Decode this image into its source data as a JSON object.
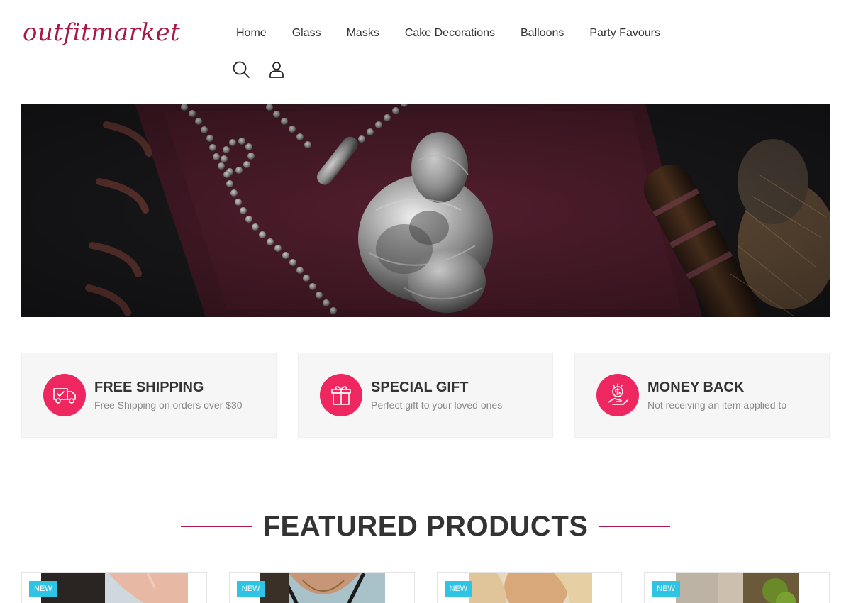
{
  "header": {
    "logo_text": "outfitmarket",
    "logo_color": "#a8184a",
    "nav": [
      {
        "label": "Home"
      },
      {
        "label": "Glass"
      },
      {
        "label": "Masks"
      },
      {
        "label": "Cake Decorations"
      },
      {
        "label": "Balloons"
      },
      {
        "label": "Party Favours"
      }
    ],
    "icons": [
      "search-icon",
      "user-icon"
    ]
  },
  "hero": {
    "image": "dragon-pendant-necklace-banner"
  },
  "features": [
    {
      "icon": "delivery-truck-icon",
      "title": "FREE SHIPPING",
      "subtitle": "Free Shipping on orders over $30"
    },
    {
      "icon": "gift-box-icon",
      "title": "SPECIAL GIFT",
      "subtitle": "Perfect gift to your loved ones"
    },
    {
      "icon": "money-hand-icon",
      "title": "MONEY BACK",
      "subtitle": "Not receiving an item applied to"
    }
  ],
  "accent_color": "#ee2761",
  "badge_color": "#2fc4e4",
  "featured": {
    "title": "FEATURED PRODUCTS",
    "products": [
      {
        "badge": "NEW"
      },
      {
        "badge": "NEW"
      },
      {
        "badge": "NEW"
      },
      {
        "badge": "NEW"
      }
    ]
  }
}
